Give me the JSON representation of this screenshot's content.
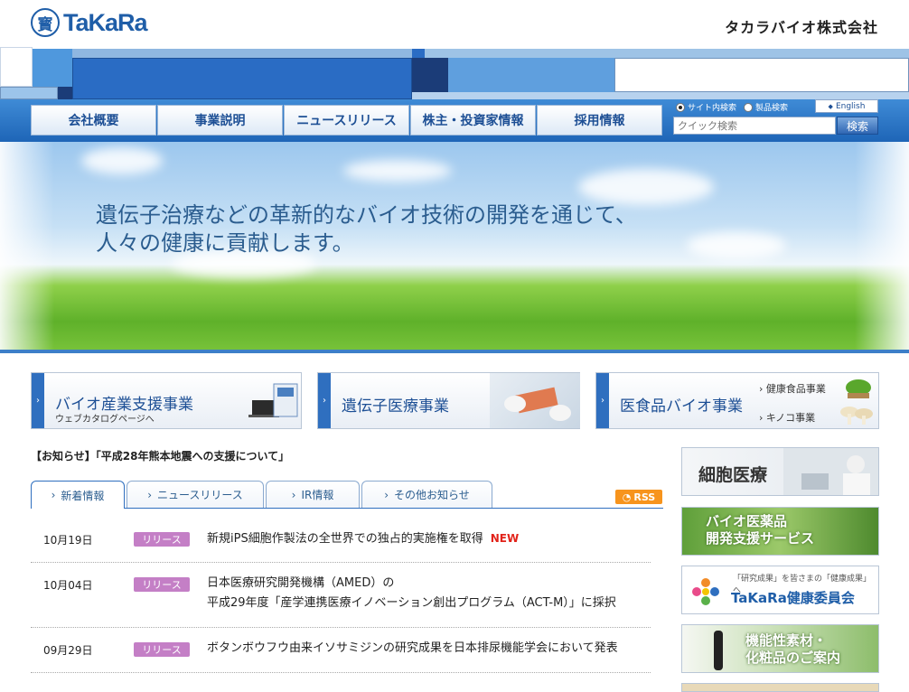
{
  "header": {
    "logo_mark": "寳",
    "logo_text": "TaKaRa",
    "company_name": "タカラバイオ株式会社"
  },
  "nav": {
    "items": [
      "会社概要",
      "事業説明",
      "ニュースリリース",
      "株主・投資家情報",
      "採用情報"
    ]
  },
  "search": {
    "option_site": "サイト内検索",
    "option_product": "製品検索",
    "english_link": "English",
    "placeholder": "クイック検索",
    "button": "検索"
  },
  "hero": {
    "line1": "遺伝子治療などの革新的なバイオ技術の開発を通じて、",
    "line2": "人々の健康に貢献します。"
  },
  "banners": [
    {
      "title": "バイオ産業支援事業",
      "sub": "ウェブカタログページへ"
    },
    {
      "title": "遺伝子医療事業",
      "sub": ""
    },
    {
      "title": "医食品バイオ事業",
      "sub": "",
      "items": [
        "健康食品事業",
        "キノコ事業"
      ]
    }
  ],
  "notice": "【お知らせ】「平成28年熊本地震への支援について」",
  "tabs": [
    "新着情報",
    "ニュースリリース",
    "IR情報",
    "その他お知らせ"
  ],
  "rss_label": "RSS",
  "news": [
    {
      "date": "10月19日",
      "badge": "リリース",
      "text": "新規iPS細胞作製法の全世界での独占的実施権を取得",
      "new_label": "NEW"
    },
    {
      "date": "10月04日",
      "badge": "リリース",
      "text": "日本医療研究開発機構（AMED）の",
      "text2": "平成29年度「産学連携医療イノベーション創出プログラム（ACT-M）」に採択"
    },
    {
      "date": "09月29日",
      "badge": "リリース",
      "text": "ボタンボウフウ由来イソサミジンの研究成果を日本排尿機能学会において発表"
    }
  ],
  "side_banners": {
    "cell": "細胞医療",
    "bio_line1": "バイオ医薬品",
    "bio_line2": "開発支援サービス",
    "health_tagline": "「研究成果」を皆さまの「健康成果」へ",
    "health_title": "TaKaRa健康委員会",
    "func_line1": "機能性素材・",
    "func_line2": "化粧品のご案内"
  },
  "colors": {
    "brand_blue": "#1f5ea8",
    "nav_blue": "#2f6fbf",
    "badge_purple": "#c47fc6",
    "new_red": "#e2231a",
    "rss_orange": "#f7941d"
  }
}
